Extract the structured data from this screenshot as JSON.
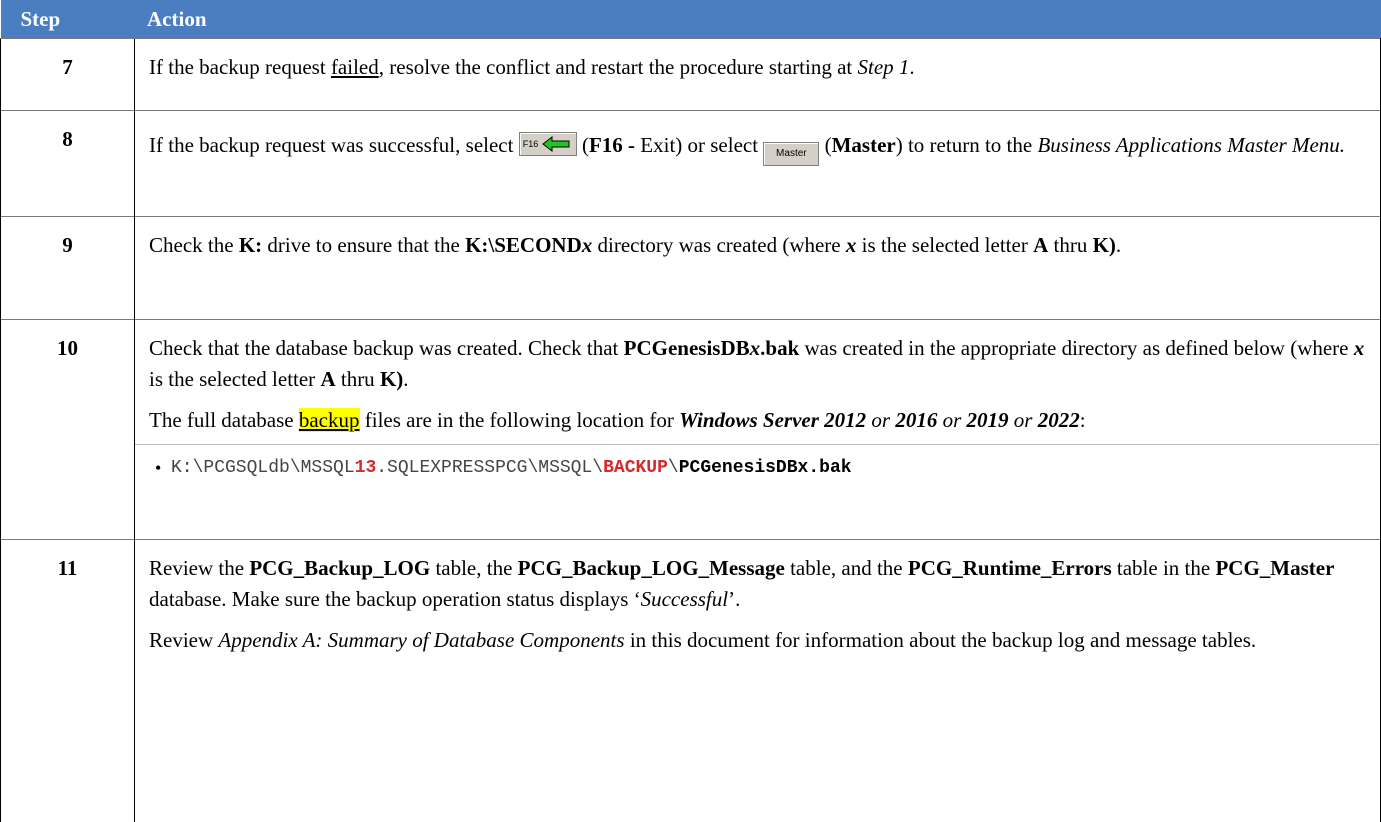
{
  "header": {
    "step": "Step",
    "action": "Action"
  },
  "rows": {
    "r7": {
      "step": "7",
      "t1": "If the backup request ",
      "t2": "failed",
      "t3": ", resolve the conflict and restart the procedure starting at ",
      "t4": "Step 1",
      "t5": "."
    },
    "r8": {
      "step": "8",
      "t1": "If the backup request was successful, select ",
      "f16_label": "F16",
      "t2": " (",
      "t3": "F16 -",
      "t4": " Exit) or select ",
      "master_label": "Master",
      "t5": " (",
      "t6": "Master",
      "t7": ") to return to the ",
      "t8": "Business Applications Master Menu.",
      "icon_f16": "exit-arrow-icon",
      "icon_master": "master-button"
    },
    "r9": {
      "step": "9",
      "t1": "Check the ",
      "t2": "K:",
      "t3": " drive to ensure that the ",
      "t4": "K:\\SECOND",
      "t5": "x",
      "t6": " directory was created (where ",
      "t7": "x",
      "t8": " is the selected letter ",
      "t9": "A",
      "t10": " thru ",
      "t11": "K)",
      "t12": "."
    },
    "r10": {
      "step": "10",
      "p1": {
        "t1": "Check that the database backup was created.  Check that ",
        "t2": "PCGenesisDB",
        "t3": "x",
        "t4": ".bak",
        "t5": " was created in the appropriate directory as defined below (where ",
        "t6": "x",
        "t7": " is the selected letter ",
        "t8": "A",
        "t9": " thru ",
        "t10": "K)",
        "t11": "."
      },
      "p2": {
        "t1": "The full database ",
        "t2": "backup",
        "t3": " files are in the following location for ",
        "t4": "Windows Server 2012",
        "t5": " or ",
        "t6": "2016",
        "t7": " or ",
        "t8": "2019",
        "t9": " or ",
        "t10": "2022",
        "t11": ":"
      },
      "path": {
        "a": "K:\\PCGSQLdb\\MSSQL",
        "b": "13",
        "c": ".SQLEXPRESSPCG\\MSSQL\\",
        "d": "BACKUP",
        "e": "\\",
        "f": "PCGenesisDBx.bak"
      }
    },
    "r11": {
      "step": "11",
      "p1": {
        "t1": "Review the ",
        "t2": "PCG_Backup_LOG",
        "t3": " table, the ",
        "t4": "PCG_Backup_LOG_Message",
        "t5": " table, and the ",
        "t6": "PCG_Runtime_Errors",
        "t7": " table in the ",
        "t8": "PCG_Master",
        "t9": " database.  Make sure the backup operation status displays ‘",
        "t10": "Successful",
        "t11": "’."
      },
      "p2": {
        "t1": "Review ",
        "t2": "Appendix A:  Summary of Database Components",
        "t3": " in this document for information about the backup log and message tables."
      }
    }
  },
  "colors": {
    "header_bg": "#4a7ec0",
    "highlight": "#ffff00",
    "path_red": "#d42a2a"
  }
}
